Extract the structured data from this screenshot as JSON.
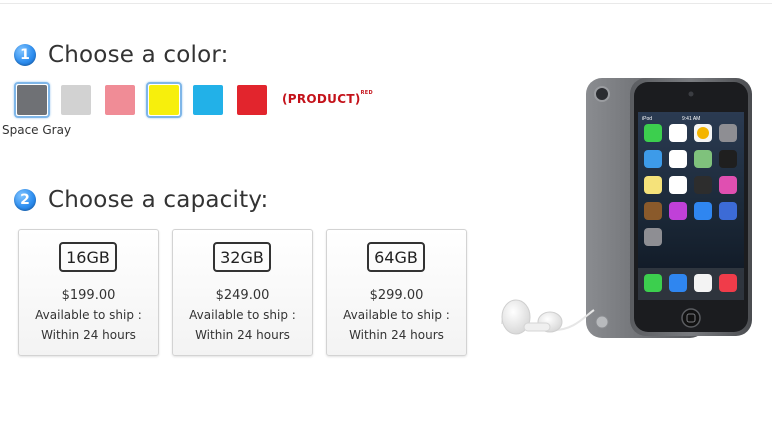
{
  "step1": {
    "number": "1",
    "title": "Choose a color:"
  },
  "colors": [
    {
      "name": "Space Gray",
      "hex": "#6f7175",
      "selected": true
    },
    {
      "name": "Silver",
      "hex": "#d2d2d2"
    },
    {
      "name": "Pink",
      "hex": "#f08c96"
    },
    {
      "name": "Yellow",
      "hex": "#f7ef0c",
      "selected_outline": true
    },
    {
      "name": "Blue",
      "hex": "#22b1e8"
    },
    {
      "name": "Red",
      "hex": "#e2252d"
    }
  ],
  "product_red": {
    "text": "(PRODUCT)",
    "sup": "RED"
  },
  "selected_color_label": "Space Gray",
  "step2": {
    "number": "2",
    "title": "Choose a capacity:"
  },
  "capacities": [
    {
      "size": "16GB",
      "price": "$199.00",
      "availability": "Available to ship :",
      "ship_time": "Within 24 hours"
    },
    {
      "size": "32GB",
      "price": "$249.00",
      "availability": "Available to ship :",
      "ship_time": "Within 24 hours"
    },
    {
      "size": "64GB",
      "price": "$299.00",
      "availability": "Available to ship :",
      "ship_time": "Within 24 hours"
    }
  ],
  "product_image": {
    "status_time": "9:41 AM",
    "carrier": "iPod"
  }
}
